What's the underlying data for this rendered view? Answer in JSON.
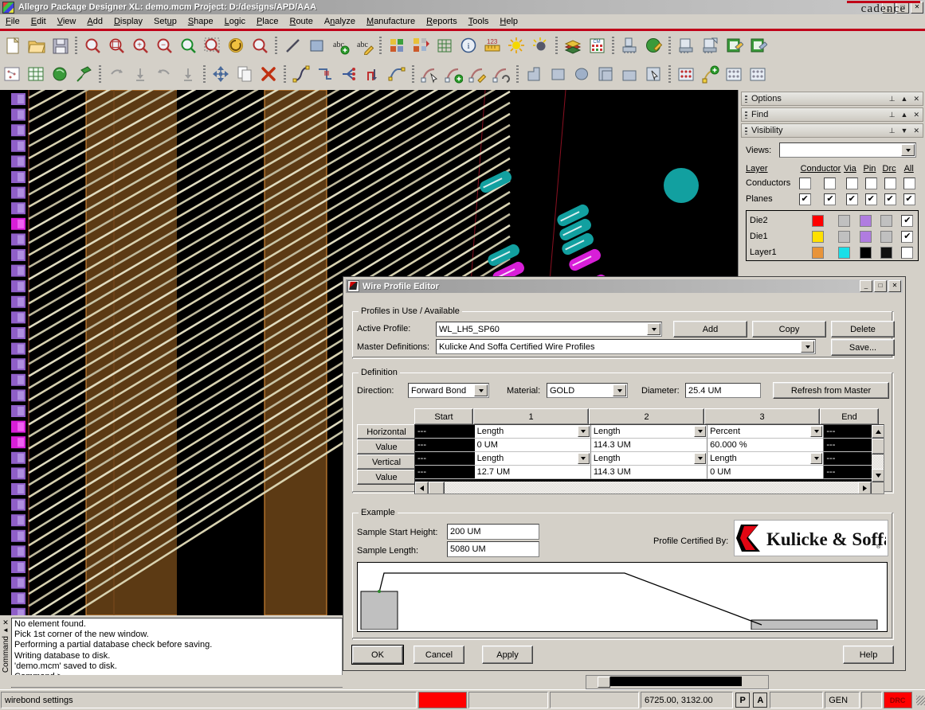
{
  "window": {
    "title": "Allegro Package Designer XL: demo.mcm   Project: D:/designs/APD/AAA",
    "minimize": "_",
    "maximize": "□",
    "close": "✕"
  },
  "brand": {
    "logo_text": "cadence",
    "accent": "#c00018"
  },
  "menu": [
    {
      "label": "File",
      "accel": "F"
    },
    {
      "label": "Edit",
      "accel": "E"
    },
    {
      "label": "View",
      "accel": "V"
    },
    {
      "label": "Add",
      "accel": "A"
    },
    {
      "label": "Display",
      "accel": "D"
    },
    {
      "label": "Setup",
      "accel": "u"
    },
    {
      "label": "Shape",
      "accel": "S"
    },
    {
      "label": "Logic",
      "accel": "L"
    },
    {
      "label": "Place",
      "accel": "P"
    },
    {
      "label": "Route",
      "accel": "R"
    },
    {
      "label": "Analyze",
      "accel": "n"
    },
    {
      "label": "Manufacture",
      "accel": "M"
    },
    {
      "label": "Reports",
      "accel": "R"
    },
    {
      "label": "Tools",
      "accel": "T"
    },
    {
      "label": "Help",
      "accel": "H"
    }
  ],
  "toolbar1": [
    {
      "icon": "new-file-icon"
    },
    {
      "icon": "open-folder-icon"
    },
    {
      "icon": "save-disk-icon"
    },
    {
      "sep": true
    },
    {
      "icon": "zoom-fit-icon"
    },
    {
      "icon": "zoom-window-icon"
    },
    {
      "icon": "zoom-in-icon"
    },
    {
      "icon": "zoom-out-icon"
    },
    {
      "icon": "zoom-previous-icon"
    },
    {
      "icon": "zoom-selection-icon"
    },
    {
      "icon": "redraw-icon"
    },
    {
      "icon": "zoom-center-icon"
    },
    {
      "sep": true
    },
    {
      "icon": "line-icon"
    },
    {
      "icon": "rectangle-icon"
    },
    {
      "icon": "add-text-icon"
    },
    {
      "icon": "edit-text-icon"
    },
    {
      "sep": true
    },
    {
      "icon": "color-palette-icon"
    },
    {
      "icon": "swap-layers-icon"
    },
    {
      "icon": "grid-toggle-icon"
    },
    {
      "icon": "info-icon"
    },
    {
      "icon": "measure-icon"
    },
    {
      "icon": "highlight-icon"
    },
    {
      "icon": "dehighlight-icon"
    },
    {
      "sep": true
    },
    {
      "icon": "layer-stack-icon"
    },
    {
      "icon": "constraint-manager-icon"
    },
    {
      "sep": true
    },
    {
      "icon": "component-place-icon"
    },
    {
      "icon": "shape-fill-icon"
    },
    {
      "sep": true
    },
    {
      "icon": "die-stack-icon"
    },
    {
      "icon": "die-edit-icon"
    },
    {
      "icon": "net-report-icon"
    },
    {
      "icon": "net-edit-icon"
    }
  ],
  "toolbar2": [
    {
      "icon": "subdrawing-icon"
    },
    {
      "icon": "grid-drawing-icon"
    },
    {
      "icon": "shape-green-icon"
    },
    {
      "icon": "pin-icon"
    },
    {
      "sep": true
    },
    {
      "icon": "undo-icon"
    },
    {
      "icon": "undo-step-icon"
    },
    {
      "icon": "redo-icon"
    },
    {
      "icon": "redo-step-icon"
    },
    {
      "sep": true
    },
    {
      "icon": "move-icon"
    },
    {
      "icon": "copy-icon"
    },
    {
      "icon": "delete-icon"
    },
    {
      "sep": true
    },
    {
      "icon": "add-connect-icon"
    },
    {
      "icon": "slide-icon"
    },
    {
      "icon": "fanout-icon"
    },
    {
      "icon": "via-route-icon"
    },
    {
      "icon": "custom-smooth-icon"
    },
    {
      "sep": true
    },
    {
      "icon": "wirebond-select-icon"
    },
    {
      "icon": "wirebond-add-icon"
    },
    {
      "icon": "wirebond-edit-icon"
    },
    {
      "icon": "wirebond-query-icon"
    },
    {
      "sep": true
    },
    {
      "icon": "shape-polygon-icon"
    },
    {
      "icon": "shape-rect-icon"
    },
    {
      "icon": "shape-circle-icon"
    },
    {
      "icon": "shape-compose-icon"
    },
    {
      "icon": "shape-void-icon"
    },
    {
      "icon": "shape-select-icon"
    },
    {
      "sep": true
    },
    {
      "icon": "bond-finger-icon"
    },
    {
      "icon": "bond-wire-add-icon"
    },
    {
      "icon": "bond-pad-icon"
    },
    {
      "icon": "bond-array-icon"
    }
  ],
  "panels": {
    "options": {
      "title": "Options",
      "pin": "⊥",
      "collapse": "▲",
      "close": "✕"
    },
    "find": {
      "title": "Find",
      "pin": "⊥",
      "collapse": "▲",
      "close": "✕"
    },
    "visibility": {
      "title": "Visibility",
      "pin": "⊥",
      "collapse": "▼",
      "close": "✕",
      "views_label": "Views:",
      "views_value": "",
      "columns": [
        "Layer",
        "Conductor",
        "Via",
        "Pin",
        "Drc",
        "All"
      ],
      "global_rows": [
        {
          "name": "Conductors",
          "layer_checked": false,
          "checks": [
            false,
            false,
            false,
            false,
            false
          ]
        },
        {
          "name": "Planes",
          "layer_checked": true,
          "checks": [
            true,
            true,
            true,
            true,
            true
          ]
        }
      ],
      "layers": [
        {
          "name": "Die2",
          "swatches": [
            "#ff0000",
            "#c0c0c0",
            "#b07ce0",
            "#c0c0c0"
          ],
          "all_checked": true
        },
        {
          "name": "Die1",
          "swatches": [
            "#ffe000",
            "#c0c0c0",
            "#b07ce0",
            "#c0c0c0"
          ],
          "all_checked": true
        },
        {
          "name": "Layer1",
          "swatches": [
            "#e8943a",
            "#19dfe8",
            "#000000",
            "#111111"
          ],
          "all_checked": false
        }
      ]
    }
  },
  "console": {
    "label": "Command",
    "close": "✕",
    "collapse": "◄",
    "pin": "⊥",
    "lines": [
      "No element found.",
      "Pick 1st corner of the new window.",
      "Performing a partial database check before saving.",
      "Writing database to disk.",
      "'demo.mcm' saved to disk.",
      "Command >"
    ]
  },
  "statusbar": {
    "mode": "wirebond settings",
    "coordinates": "6725.00, 3132.00",
    "pick_button": "P",
    "align_button": "A",
    "gen_label": "GEN",
    "drc_label": "DRC",
    "drc_color": "#ff0000"
  },
  "dialog": {
    "title": "Wire Profile Editor",
    "minimize": "_",
    "maximize": "□",
    "close": "✕",
    "profiles_group": {
      "legend": "Profiles in Use / Available",
      "active_profile_label": "Active Profile:",
      "active_profile_value": "WL_LH5_SP60",
      "master_definitions_label": "Master Definitions:",
      "master_definitions_value": "Kulicke And Soffa Certified Wire Profiles",
      "buttons": [
        "Add",
        "Copy",
        "Delete",
        "Save..."
      ]
    },
    "definition_group": {
      "legend": "Definition",
      "direction_label": "Direction:",
      "direction_value": "Forward Bond",
      "material_label": "Material:",
      "material_value": "GOLD",
      "diameter_label": "Diameter:",
      "diameter_value": "25.4 UM",
      "refresh_button": "Refresh from Master",
      "columns": [
        "Start",
        "1",
        "2",
        "3",
        "End"
      ],
      "rows": [
        {
          "label": "Horizontal",
          "type": "combo",
          "cells": [
            "---",
            "Length",
            "Length",
            "Percent",
            "---"
          ]
        },
        {
          "label": "Value",
          "type": "text",
          "cells": [
            "---",
            "0 UM",
            "114.3 UM",
            "60.000 %",
            "---"
          ]
        },
        {
          "label": "Vertical",
          "type": "combo",
          "cells": [
            "---",
            "Length",
            "Length",
            "Length",
            "---"
          ]
        },
        {
          "label": "Value",
          "type": "text",
          "cells": [
            "---",
            "12.7 UM",
            "114.3 UM",
            "0 UM",
            "---"
          ]
        }
      ]
    },
    "example_group": {
      "legend": "Example",
      "start_height_label": "Sample Start Height:",
      "start_height_value": "200 UM",
      "length_label": "Sample Length:",
      "length_value": "5080 UM",
      "certified_label": "Profile Certified By:",
      "certifier": "Kulicke & Soffa",
      "certifier_mark": "K"
    },
    "footer_buttons": [
      {
        "label": "OK",
        "default": true
      },
      {
        "label": "Cancel",
        "default": false
      },
      {
        "label": "Apply",
        "default": false
      }
    ],
    "help_button": "Help"
  }
}
